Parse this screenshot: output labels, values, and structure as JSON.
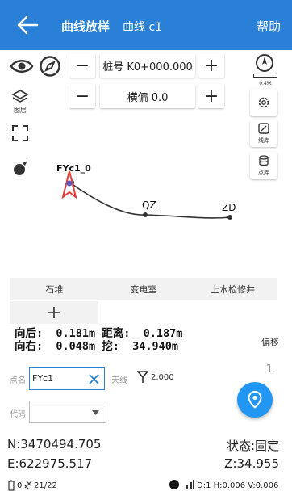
{
  "header": {
    "title": "曲线放样",
    "subtitle": "曲线 c1",
    "help_label": "帮助"
  },
  "map": {
    "station_label": "桩号 K0+000.000",
    "offset_label": "横偏 0.0",
    "minus_symbol": "−",
    "plus_symbol": "+",
    "scale_text": "0.4米",
    "layer_label": "图层",
    "line_lib_label": "线库",
    "point_lib_label": "点库",
    "point_labels": {
      "start": "FYc1_0",
      "qz": "QZ",
      "zd": "ZD"
    }
  },
  "quick_codes": [
    "石堆",
    "变电室",
    "上水检修井"
  ],
  "add_code_symbol": "+",
  "stake": {
    "line1": "向后:  0.181m 距离:  0.187m",
    "line2": "向右:  0.048m 挖:  34.940m",
    "offset_button": "偏移",
    "count": "1"
  },
  "form": {
    "point_name_label": "点名",
    "point_name_value": "FYc1",
    "antenna_label": "天线",
    "antenna_value": "2.000",
    "code_label": "代码",
    "code_value": ""
  },
  "coords": {
    "n": "N:3470494.705",
    "e": "E:622975.517",
    "status": "状态:固定",
    "z": "Z:34.955"
  },
  "statusbar": {
    "sats": "21/22",
    "sats_prefix": "0",
    "precision": "D:1 H:0.006 V:0.006"
  },
  "colors": {
    "accent": "#2a7fd6",
    "fab": "#2196f3",
    "point_marker": "#e53935"
  }
}
